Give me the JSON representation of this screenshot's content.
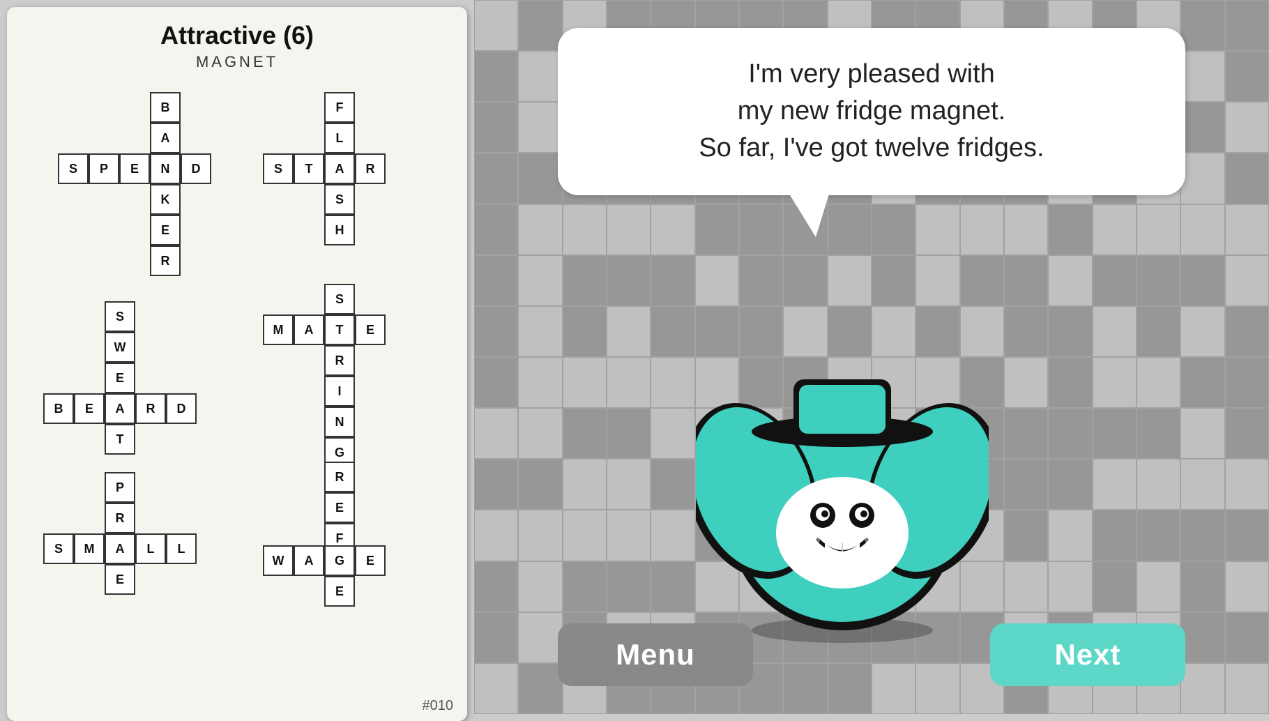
{
  "left": {
    "title": "Attractive (6)",
    "subtitle": "MAGNET",
    "puzzle_number": "#010",
    "crosswords": [
      {
        "id": "cw1",
        "comment": "BANKER vertical + SPEND horizontal crossing at N",
        "horizontal": {
          "word": "SPEND",
          "row": 4,
          "col": 0
        },
        "vertical": {
          "word": "BANKER",
          "row": 0,
          "col": 3
        }
      }
    ]
  },
  "right": {
    "speech": "I'm very pleased with\nmy new fridge magnet.\nSo far, I've got twelve fridges.",
    "buttons": {
      "menu": "Menu",
      "next": "Next"
    }
  },
  "colors": {
    "teal": "#3ecfbe",
    "dark_teal": "#2ab5a5",
    "gray_btn": "#888888",
    "bg_right": "#b0b0b0"
  }
}
